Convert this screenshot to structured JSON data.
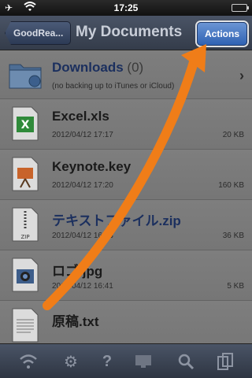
{
  "status_bar": {
    "time": "17:25"
  },
  "nav": {
    "back_label": "GoodRea...",
    "title": "My Documents",
    "actions_label": "Actions"
  },
  "folder": {
    "name": "Downloads",
    "count": "(0)",
    "note": "(no backing up to iTunes or iCloud)"
  },
  "files": [
    {
      "name": "Excel.xls",
      "date": "2012/04/12 17:17",
      "size": "20 KB",
      "icon": "excel-file-icon"
    },
    {
      "name": "Keynote.key",
      "date": "2012/04/12 17:20",
      "size": "160 KB",
      "icon": "keynote-file-icon"
    },
    {
      "name": "テキストファイル.zip",
      "date": "2012/04/12 16:53",
      "size": "36 KB",
      "icon": "zip-file-icon"
    },
    {
      "name": "ロゴ.jpg",
      "date": "2012/04/12 16:41",
      "size": "5 KB",
      "icon": "image-file-icon"
    },
    {
      "name": "原稿.txt",
      "date": "",
      "size": "",
      "icon": "text-file-icon"
    }
  ],
  "toolbar": [
    "wifi-icon",
    "gear-icon",
    "help-icon",
    "monitor-icon",
    "search-icon",
    "multi-select-icon"
  ],
  "colors": {
    "arrow": "#f07d18",
    "actions_button": "#3a6cc0"
  }
}
